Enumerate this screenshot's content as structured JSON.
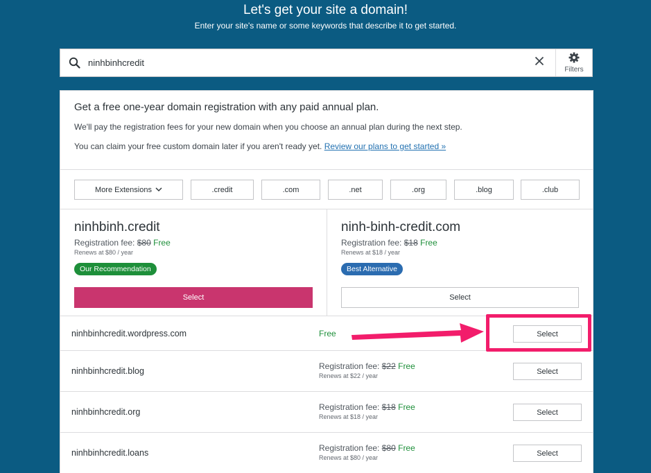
{
  "hero": {
    "title": "Let's get your site a domain!",
    "subtitle": "Enter your site's name or some keywords that describe it to get started."
  },
  "search": {
    "value": "ninhbinhcredit",
    "filters_label": "Filters",
    "search_icon": "search-icon",
    "clear_icon": "close-icon",
    "filters_icon": "gear-icon"
  },
  "promo": {
    "title": "Get a free one-year domain registration with any paid annual plan.",
    "line1": "We'll pay the registration fees for your new domain when you choose an annual plan during the next step.",
    "line2": "You can claim your free custom domain later if you aren't ready yet.",
    "link": "Review our plans to get started »"
  },
  "extensions": {
    "more_label": "More Extensions",
    "tlds": [
      ".credit",
      ".com",
      ".net",
      ".org",
      ".blog",
      ".club"
    ]
  },
  "featured": [
    {
      "domain": "ninhbinh.credit",
      "fee_label": "Registration fee:",
      "old_price": "$80",
      "free_label": "Free",
      "renews": "Renews at $80 / year",
      "badge": "Our Recommendation",
      "button": "Select"
    },
    {
      "domain": "ninh-binh-credit.com",
      "fee_label": "Registration fee:",
      "old_price": "$18",
      "free_label": "Free",
      "renews": "Renews at $18 / year",
      "badge": "Best Alternative",
      "button": "Select"
    }
  ],
  "results": [
    {
      "domain": "ninhbinhcredit.wordpress.com",
      "free_label": "Free",
      "button": "Select"
    },
    {
      "domain": "ninhbinhcredit.blog",
      "fee_label": "Registration fee:",
      "old_price": "$22",
      "free_label": "Free",
      "renews": "Renews at $22 / year",
      "button": "Select"
    },
    {
      "domain": "ninhbinhcredit.org",
      "fee_label": "Registration fee:",
      "old_price": "$18",
      "free_label": "Free",
      "renews": "Renews at $18 / year",
      "button": "Select"
    },
    {
      "domain": "ninhbinhcredit.loans",
      "fee_label": "Registration fee:",
      "old_price": "$80",
      "free_label": "Free",
      "renews": "Renews at $80 / year",
      "button": "Select"
    }
  ],
  "colors": {
    "background": "#0b5b82",
    "primary_button": "#c9356e",
    "free_text": "#1e8f3a",
    "badge_recommendation": "#1e8f3a",
    "badge_alternative": "#2b6cb0",
    "annotation": "#f21d6b",
    "link": "#2271b1"
  }
}
